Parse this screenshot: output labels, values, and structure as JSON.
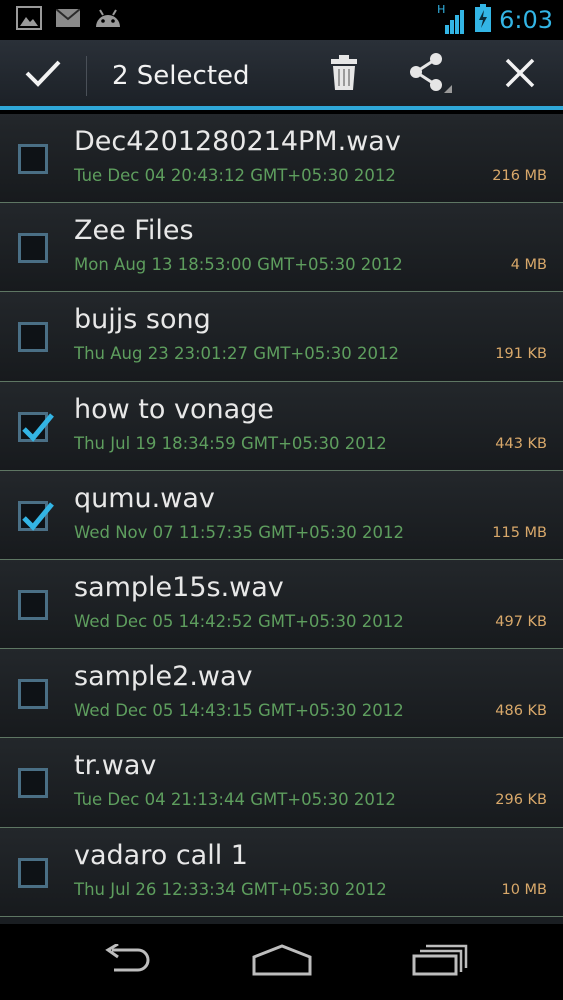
{
  "status_bar": {
    "time": "6:03",
    "network_type": "H",
    "icons": [
      "gallery-icon",
      "mail-icon",
      "android-icon",
      "signal-icon",
      "battery-charging-icon"
    ]
  },
  "action_bar": {
    "title": "2 Selected",
    "accent_color": "#33b5e5"
  },
  "files": [
    {
      "name": "Dec4201280214PM.wav",
      "date": "Tue Dec 04 20:43:12 GMT+05:30 2012",
      "size": "216 MB",
      "checked": false
    },
    {
      "name": "Zee Files",
      "date": "Mon Aug 13 18:53:00 GMT+05:30 2012",
      "size": "4 MB",
      "checked": false
    },
    {
      "name": "bujjs song",
      "date": "Thu Aug 23 23:01:27 GMT+05:30 2012",
      "size": "191 KB",
      "checked": false
    },
    {
      "name": "how to vonage",
      "date": "Thu Jul 19 18:34:59 GMT+05:30 2012",
      "size": "443 KB",
      "checked": true
    },
    {
      "name": "qumu.wav",
      "date": "Wed Nov 07 11:57:35 GMT+05:30 2012",
      "size": "115 MB",
      "checked": true
    },
    {
      "name": "sample15s.wav",
      "date": "Wed Dec 05 14:42:52 GMT+05:30 2012",
      "size": "497 KB",
      "checked": false
    },
    {
      "name": "sample2.wav",
      "date": "Wed Dec 05 14:43:15 GMT+05:30 2012",
      "size": "486 KB",
      "checked": false
    },
    {
      "name": "tr.wav",
      "date": "Tue Dec 04 21:13:44 GMT+05:30 2012",
      "size": "296 KB",
      "checked": false
    },
    {
      "name": "vadaro call 1",
      "date": "Thu Jul 26 12:33:34 GMT+05:30 2012",
      "size": "10 MB",
      "checked": false
    }
  ]
}
